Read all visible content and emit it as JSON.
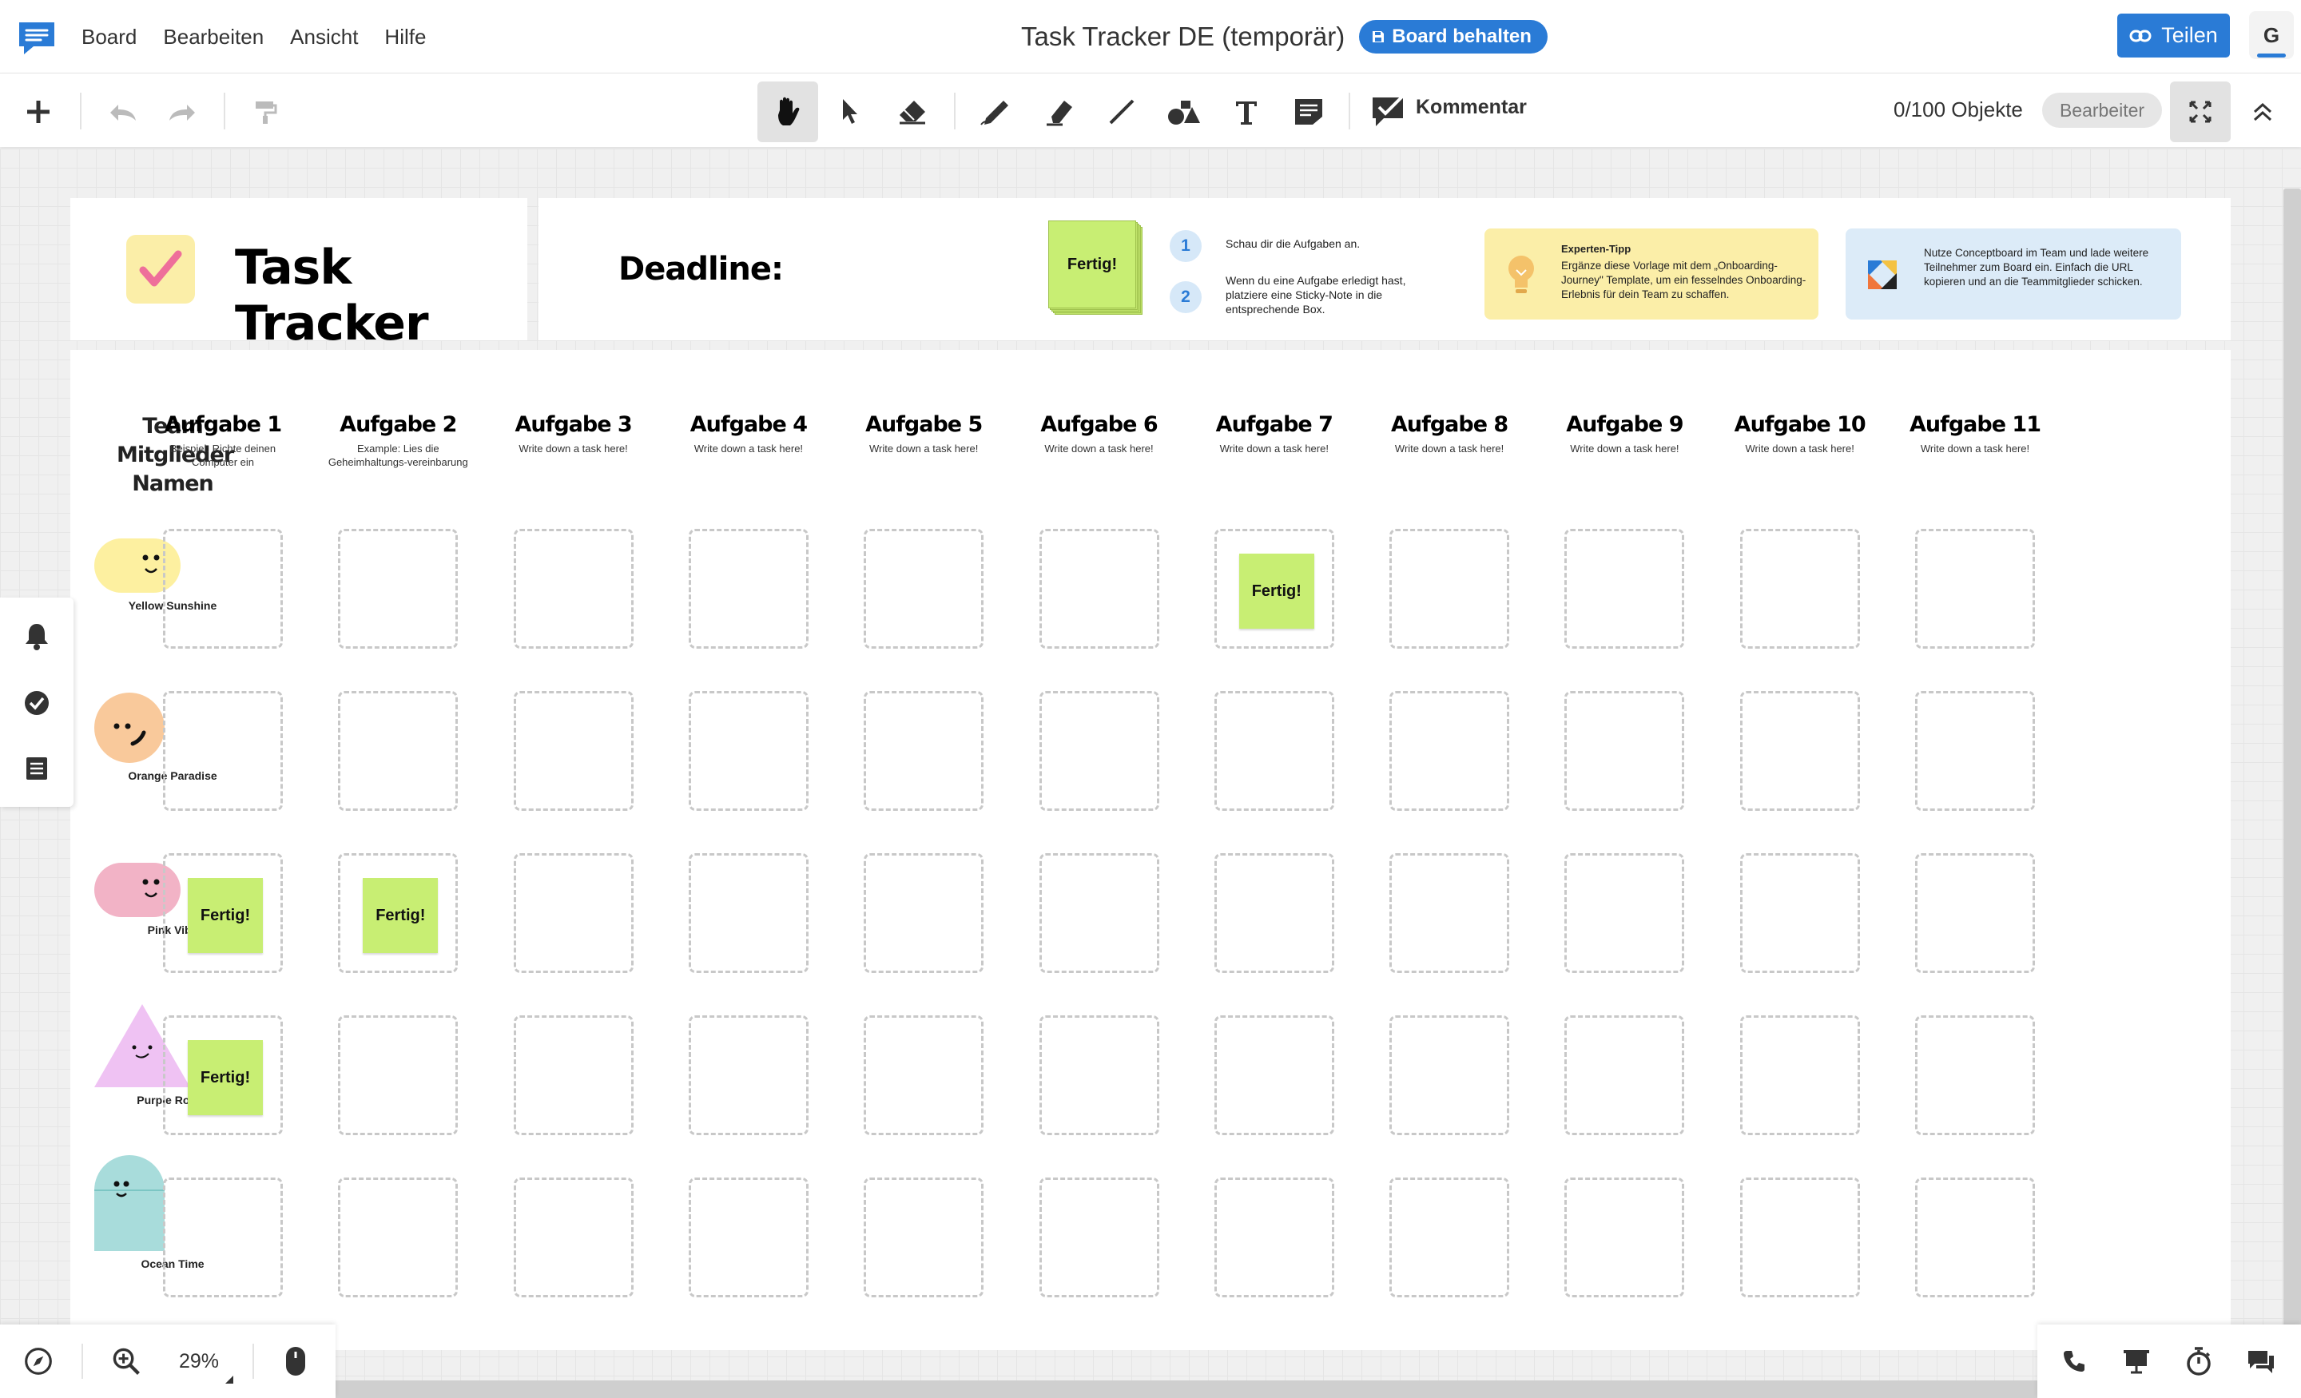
{
  "menubar": {
    "menu_items": [
      "Board",
      "Bearbeiten",
      "Ansicht",
      "Hilfe"
    ],
    "board_title": "Task Tracker DE (temporär)",
    "keep_board_label": "Board behalten",
    "share_label": "Teilen",
    "user_initial": "G"
  },
  "toolbar": {
    "comment_label": "Kommentar",
    "objects_count": "0/100 Objekte",
    "editor_label": "Bearbeiter",
    "icons": [
      "plus-icon",
      "undo-icon",
      "redo-icon",
      "format-painter-icon",
      "hand-icon",
      "pointer-icon",
      "eraser-icon",
      "pen-icon",
      "highlighter-icon",
      "line-icon",
      "shapes-icon",
      "text-icon",
      "sticky-note-icon",
      "comment-icon",
      "fit-screen-icon",
      "collapse-icon"
    ]
  },
  "header": {
    "title": "Task Tracker",
    "deadline_label": "Deadline:",
    "stack_label": "Fertig!",
    "steps": [
      {
        "num": "1",
        "text": "Schau dir die Aufgaben an."
      },
      {
        "num": "2",
        "text": "Wenn du eine Aufgabe erledigt hast, platziere eine Sticky-Note in die entsprechende Box."
      }
    ],
    "tip_title": "Experten-Tipp",
    "tip_text": "Ergänze diese Vorlage mit dem „Onboarding-Journey\" Template, um ein fesselndes Onboarding-Erlebnis für dein Team zu schaffen.",
    "share_tip_text": "Nutze Conceptboard im Team und lade weitere Teilnehmer zum Board ein. Einfach die URL kopieren und an die Teammitglieder schicken."
  },
  "grid": {
    "team_header": "Team Mitglieder Namen",
    "columns": [
      {
        "title": "Aufgabe 1",
        "sub": "Beispiel: Richte deinen Computer ein"
      },
      {
        "title": "Aufgabe 2",
        "sub": "Example: Lies die Geheimhaltungs-vereinbarung"
      },
      {
        "title": "Aufgabe 3",
        "sub": "Write down a task here!"
      },
      {
        "title": "Aufgabe 4",
        "sub": "Write down a task here!"
      },
      {
        "title": "Aufgabe 5",
        "sub": "Write down a task here!"
      },
      {
        "title": "Aufgabe 6",
        "sub": "Write down a task here!"
      },
      {
        "title": "Aufgabe 7",
        "sub": "Write down a task here!"
      },
      {
        "title": "Aufgabe 8",
        "sub": "Write down a task here!"
      },
      {
        "title": "Aufgabe 9",
        "sub": "Write down a task here!"
      },
      {
        "title": "Aufgabe 10",
        "sub": "Write down a task here!"
      },
      {
        "title": "Aufgabe 11",
        "sub": "Write down a task here!"
      }
    ],
    "members": [
      {
        "name": "Yellow Sunshine",
        "shape": "pill",
        "color": "#fdf0a0",
        "done": [
          7
        ]
      },
      {
        "name": "Orange Paradise",
        "shape": "circle",
        "color": "#f9c99b",
        "done": []
      },
      {
        "name": "Pink Vibe",
        "shape": "pill",
        "color": "#f2b3c6",
        "done": [
          1,
          2
        ]
      },
      {
        "name": "Purple Rocks",
        "shape": "triangle",
        "color": "#efc2f3",
        "done": [
          1
        ]
      },
      {
        "name": "Ocean Time",
        "shape": "capsule",
        "color": "#a8dcdb",
        "done": []
      }
    ],
    "sticky_label": "Fertig!"
  },
  "bottom": {
    "zoom_level": "29%"
  },
  "colors": {
    "accent": "#2a7bd6",
    "sticky": "#c8ee73",
    "tip_yellow": "#fbeea8",
    "tip_blue": "#dcebf8"
  }
}
